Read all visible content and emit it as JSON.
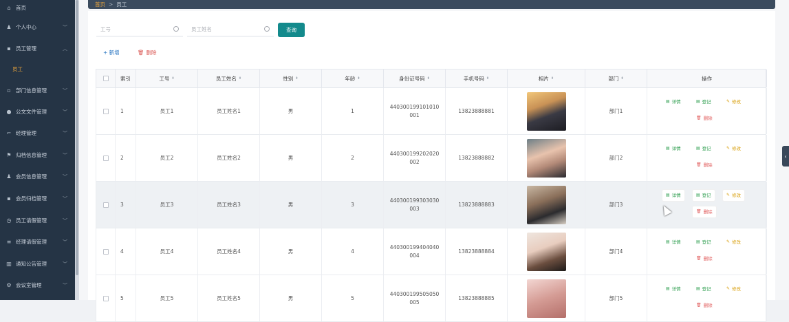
{
  "sidebar": {
    "items": [
      {
        "label": "首页",
        "icon": "home-icon",
        "glyph": "⌂"
      },
      {
        "label": "个人中心",
        "icon": "user-icon",
        "glyph": "♟"
      },
      {
        "label": "员工管理",
        "icon": "chat-icon",
        "glyph": "▪"
      },
      {
        "label": "部门信息管理",
        "icon": "chat-icon",
        "glyph": "▫"
      },
      {
        "label": "公文文件管理",
        "icon": "pin-icon",
        "glyph": "●"
      },
      {
        "label": "经理管理",
        "icon": "crop-icon",
        "glyph": "⌐"
      },
      {
        "label": "归档信息管理",
        "icon": "flag-icon",
        "glyph": "⚑"
      },
      {
        "label": "会员信息管理",
        "icon": "user-icon",
        "glyph": "♟"
      },
      {
        "label": "会员归档管理",
        "icon": "chat-icon",
        "glyph": "▪"
      },
      {
        "label": "员工请假管理",
        "icon": "clock-icon",
        "glyph": "◷"
      },
      {
        "label": "经理请假管理",
        "icon": "sliders-icon",
        "glyph": "≡"
      },
      {
        "label": "通知公告管理",
        "icon": "chart-icon",
        "glyph": "▥"
      },
      {
        "label": "会议室管理",
        "icon": "settings-icon",
        "glyph": "⚙"
      }
    ],
    "sub_item": "员工"
  },
  "breadcrumb": {
    "home": "首页",
    "separator": ">",
    "current": "员工"
  },
  "search": {
    "job_no_placeholder": "工号",
    "name_placeholder": "员工姓名",
    "query_label": "查询"
  },
  "toolbar": {
    "add_label": "+ 新增",
    "delete_label": "删除"
  },
  "table": {
    "headers": [
      "索引",
      "工号",
      "员工姓名",
      "性别",
      "年龄",
      "身份证号码",
      "手机号码",
      "相片",
      "部门",
      "操作"
    ],
    "rows": [
      {
        "index": "1",
        "job_no": "员工1",
        "name": "员工姓名1",
        "gender": "男",
        "age": "1",
        "id_card": "440300199101010001",
        "phone": "13823888881",
        "dept": "部门1"
      },
      {
        "index": "2",
        "job_no": "员工2",
        "name": "员工姓名2",
        "gender": "男",
        "age": "2",
        "id_card": "440300199202020002",
        "phone": "13823888882",
        "dept": "部门2"
      },
      {
        "index": "3",
        "job_no": "员工3",
        "name": "员工姓名3",
        "gender": "男",
        "age": "3",
        "id_card": "440300199303030003",
        "phone": "13823888883",
        "dept": "部门3"
      },
      {
        "index": "4",
        "job_no": "员工4",
        "name": "员工姓名4",
        "gender": "男",
        "age": "4",
        "id_card": "440300199404040004",
        "phone": "13823888884",
        "dept": "部门4"
      },
      {
        "index": "5",
        "job_no": "员工5",
        "name": "员工姓名5",
        "gender": "男",
        "age": "5",
        "id_card": "440300199505050005",
        "phone": "13823888885",
        "dept": "部门5"
      }
    ],
    "actions": {
      "detail": "详情",
      "register": "登记",
      "edit": "修改",
      "delete": "删除"
    }
  },
  "colors": {
    "sidebar_bg": "#253445",
    "accent": "#138a8c",
    "active_text": "#e6a23c"
  }
}
